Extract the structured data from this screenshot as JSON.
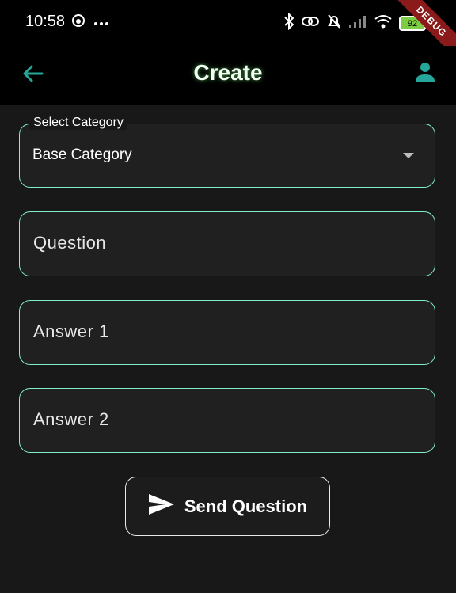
{
  "status_bar": {
    "time": "10:58",
    "battery_level": "92",
    "debug_banner": "DEBUG"
  },
  "app_bar": {
    "title": "Create",
    "back_icon": "arrow-left-icon",
    "profile_icon": "person-icon",
    "accent_color": "#26a69a"
  },
  "form": {
    "category": {
      "label": "Select Category",
      "value": "Base Category"
    },
    "question": {
      "placeholder": "Question"
    },
    "answer1": {
      "placeholder": "Answer 1"
    },
    "answer2": {
      "placeholder": "Answer 2"
    },
    "border_color": "#7ff0c8"
  },
  "send_button": {
    "label": "Send Question",
    "icon": "send-icon"
  }
}
